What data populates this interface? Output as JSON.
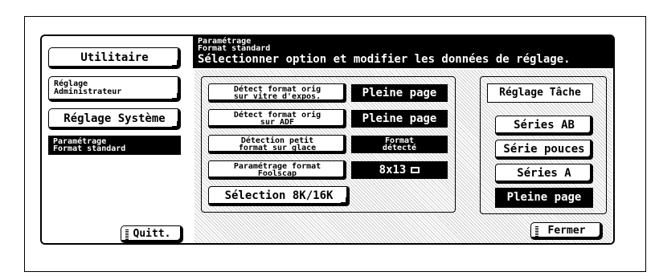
{
  "sidebar": {
    "utilitaire": "Utilitaire",
    "admin_line1": "Réglage",
    "admin_line2": "Administrateur",
    "systeme": "Réglage Système",
    "selected_line1": "Paramétrage",
    "selected_line2": "Format standard",
    "quit": "Quitt."
  },
  "header": {
    "line1": "Paramétrage",
    "line2": "Format standard",
    "instruction": "Sélectionner option et modifier les données de réglage."
  },
  "options": [
    {
      "label1": "Détect format orig",
      "label2": "sur vitre d'expos.",
      "value": "Pleine page"
    },
    {
      "label1": "Détect format orig",
      "label2": "sur ADF",
      "value": "Pleine page"
    },
    {
      "label1": "Détection petit",
      "label2": "format sur glace",
      "value1": "Format",
      "value2": "détecté"
    },
    {
      "label1": "Paramétrage format",
      "label2": "Foolscap",
      "value": "8x13"
    }
  ],
  "selection_8k16k": "Sélection 8K/16K",
  "right": {
    "title": "Réglage Tâche",
    "series_ab": "Séries AB",
    "serie_pouces": "Série pouces",
    "series_a": "Séries A",
    "pleine_page": "Pleine page"
  },
  "fermer": "Fermer"
}
